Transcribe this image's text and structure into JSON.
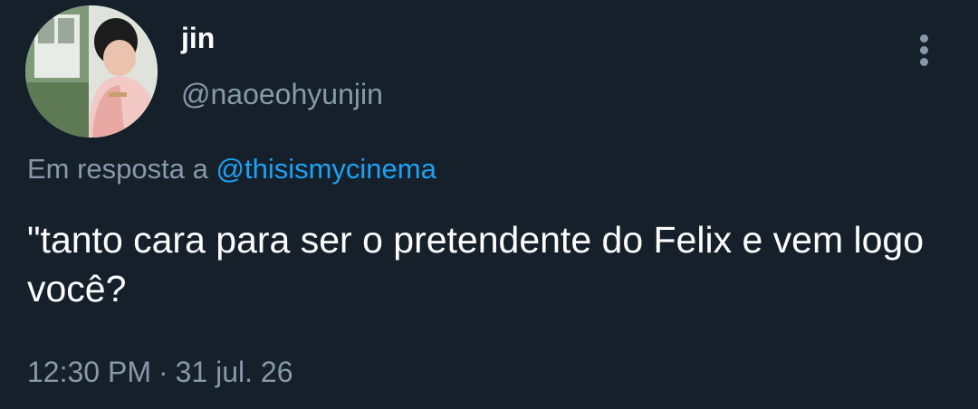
{
  "tweet": {
    "author": {
      "display_name": "jin",
      "handle": "@naoeohyunjin",
      "avatar_icon": "profile-photo"
    },
    "more_icon": "vertical-ellipsis-icon",
    "reply_to": {
      "prefix": "Em resposta a",
      "mention": "@thisismycinema"
    },
    "text": "\"tanto cara para ser o pretendente do Felix e vem logo você?",
    "time": "12:30 PM",
    "separator": "·",
    "date": "31 jul. 26"
  },
  "colors": {
    "background": "#15202b",
    "primary_text": "#ffffff",
    "secondary_text": "#8899a6",
    "accent": "#1da1f2"
  }
}
